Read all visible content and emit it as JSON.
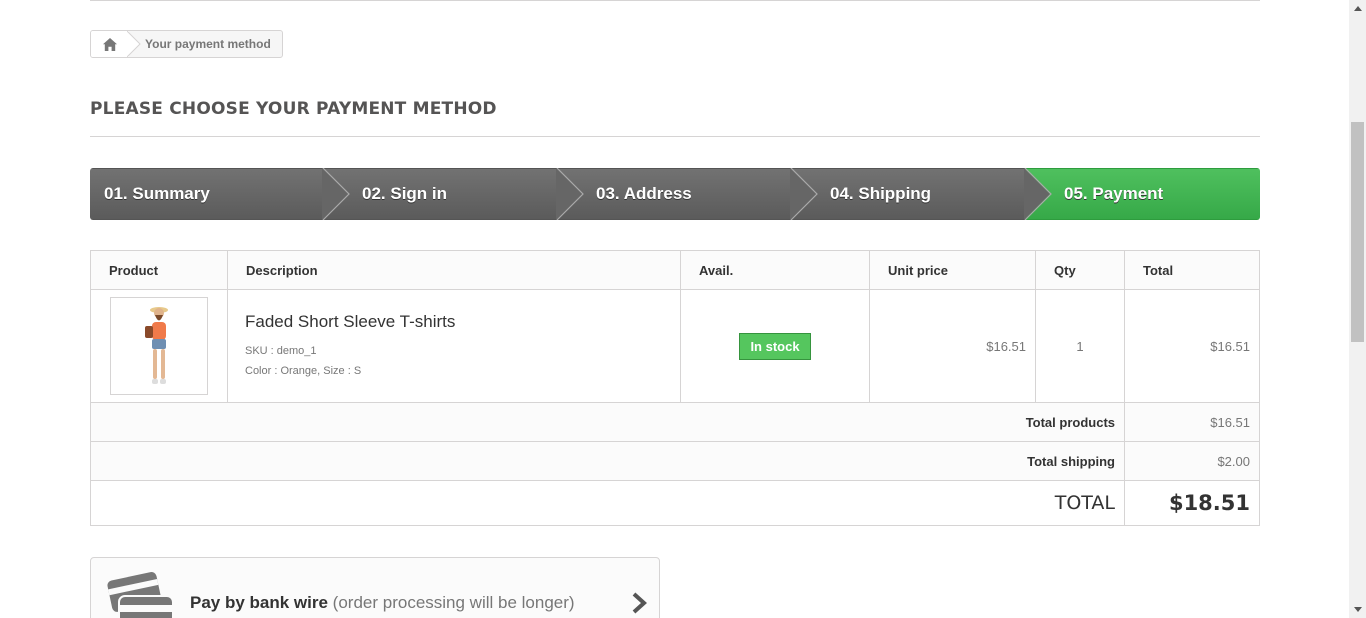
{
  "breadcrumb": {
    "home_icon": "home-icon",
    "current": "Your payment method"
  },
  "page": {
    "heading": "PLEASE CHOOSE YOUR PAYMENT METHOD"
  },
  "steps": [
    {
      "label": "01. Summary",
      "active": false
    },
    {
      "label": "02. Sign in",
      "active": false
    },
    {
      "label": "03. Address",
      "active": false
    },
    {
      "label": "04. Shipping",
      "active": false
    },
    {
      "label": "05. Payment",
      "active": true
    }
  ],
  "cart": {
    "headers": {
      "product": "Product",
      "description": "Description",
      "avail": "Avail.",
      "unit_price": "Unit price",
      "qty": "Qty",
      "total": "Total"
    },
    "items": [
      {
        "name": "Faded Short Sleeve T-shirts",
        "sku": "SKU : demo_1",
        "attributes": "Color : Orange, Size : S",
        "availability": "In stock",
        "unit_price": "$16.51",
        "qty": "1",
        "total": "$16.51"
      }
    ],
    "summary": {
      "total_products_label": "Total products",
      "total_products_value": "$16.51",
      "total_shipping_label": "Total shipping",
      "total_shipping_value": "$2.00",
      "total_label": "TOTAL",
      "total_value": "$18.51"
    }
  },
  "payment_options": [
    {
      "icon": "bankwire-card-icon",
      "label": "Pay by bank wire",
      "note": " (order processing will be longer)"
    }
  ],
  "colors": {
    "step_default": "#666666",
    "step_active": "#43b754",
    "stock_badge": "#55c65e"
  }
}
